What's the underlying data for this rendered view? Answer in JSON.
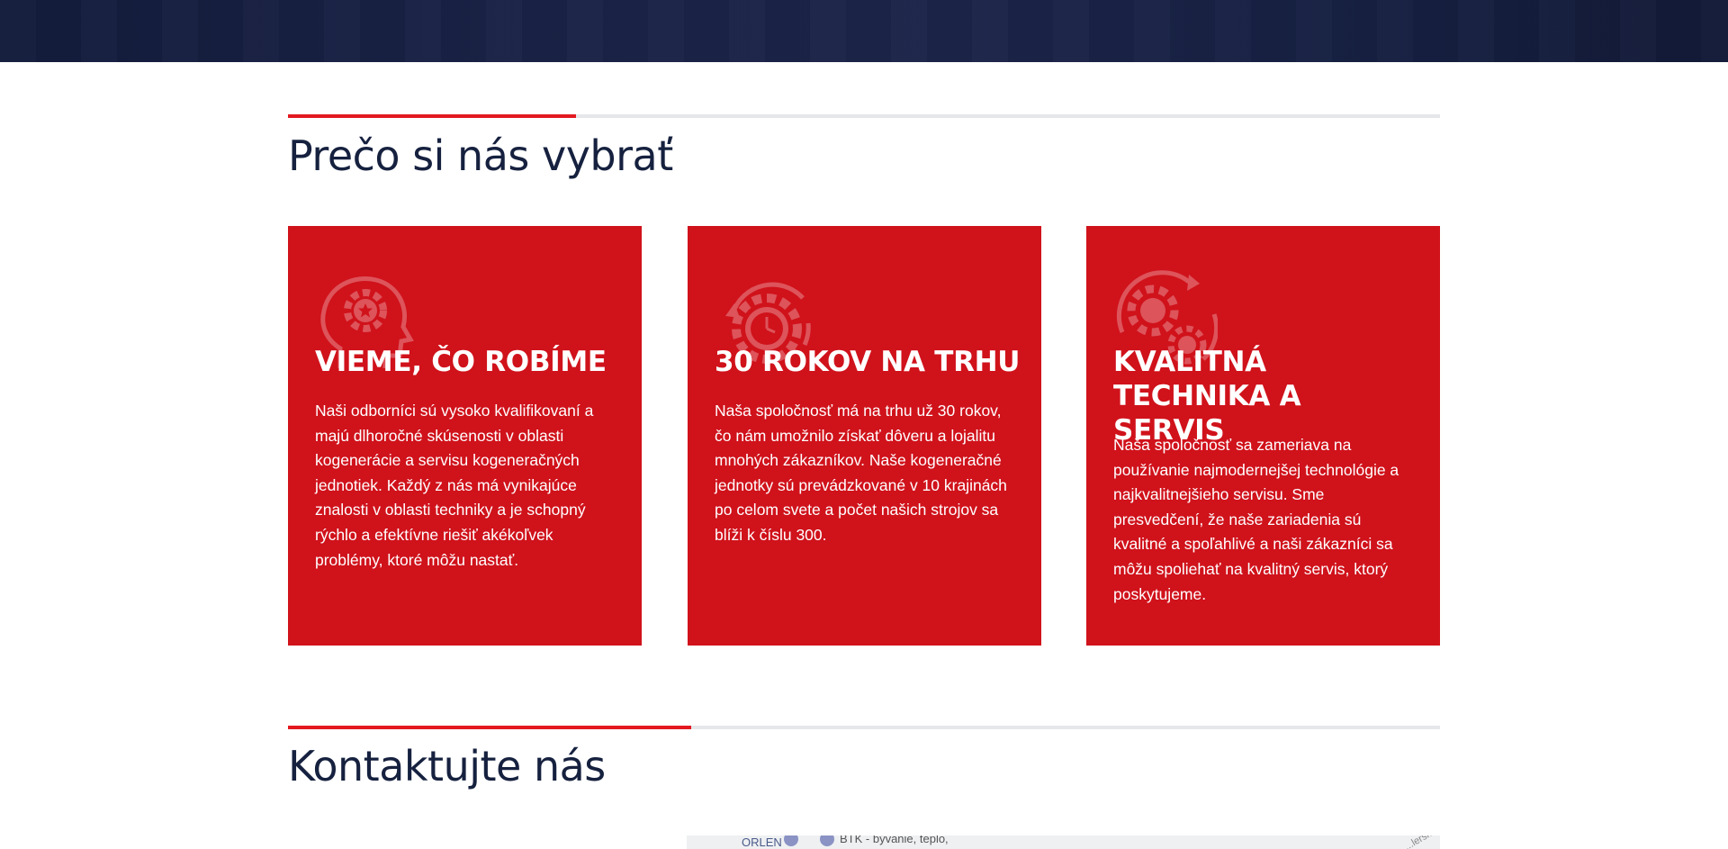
{
  "sections": {
    "why_title": "Prečo si nás vybrať",
    "contact_title": "Kontaktujte nás"
  },
  "cards": [
    {
      "icon": "head-gear-icon",
      "title": "VIEME, ČO ROBÍME",
      "text": "Naši odborníci sú vysoko kvalifikovaní a majú dlhoročné skúsenosti v oblasti kogenerácie a servisu kogeneračných jednotiek. Každý z nás má vynikajúce znalosti v oblasti techniky a je schopný rýchlo a efektívne riešiť akékoľvek problémy, ktoré môžu nastať."
    },
    {
      "icon": "gear-clock-icon",
      "title": "30 ROKOV NA TRHU",
      "text": "Naša spoločnosť má na trhu už 30 rokov, čo nám umožnilo získať dôveru a lojalitu mnohých zákazníkov. Naše kogeneračné jednotky sú prevádzkované v 10 krajinách po celom svete a počet našich strojov sa blíži k číslu 300."
    },
    {
      "icon": "gears-cycle-icon",
      "title": "KVALITNÁ TECHNIKA A SERVIS",
      "text": "Naša spoločnosť sa zameriava na používanie najmodernejšej technológie a najkvalitnejšieho servisu. Sme presvedčení, že naše zariadenia sú kvalitné a spoľahlivé a naši zákazníci sa môžu spoliehať na kvalitný servis, ktorý poskytujeme."
    }
  ],
  "map": {
    "label_1": "ORLEN",
    "label_2": "BTK - bývanie, teplo,",
    "label_3": "...lerská"
  },
  "colors": {
    "accent": "#e3191f",
    "card_bg": "#d0121b",
    "heading": "#16213f",
    "hero_bg": "#1a2346"
  }
}
